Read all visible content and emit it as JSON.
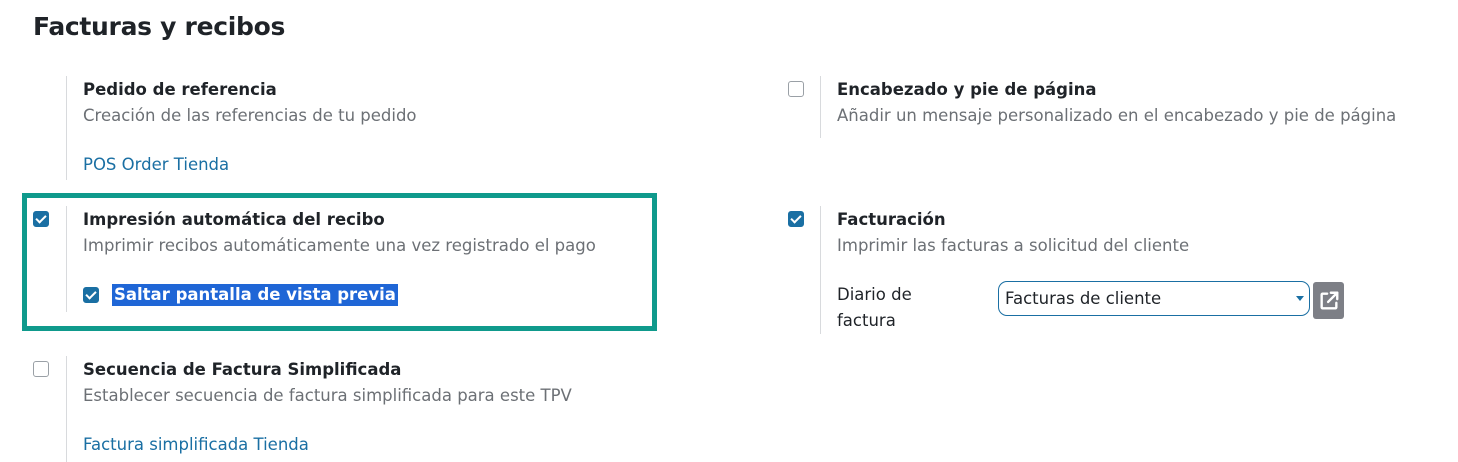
{
  "section": {
    "title": "Facturas y recibos"
  },
  "settings": {
    "order_reference": {
      "title": "Pedido de referencia",
      "description": "Creación de las referencias de tu pedido",
      "link": "POS Order Tienda"
    },
    "header_footer": {
      "checked": false,
      "title": "Encabezado y pie de página",
      "description": "Añadir un mensaje personalizado en el encabezado y pie de página"
    },
    "auto_print": {
      "checked": true,
      "title": "Impresión automática del recibo",
      "description": "Imprimir recibos automáticamente una vez registrado el pago",
      "sub_option": {
        "checked": true,
        "label": "Saltar pantalla de vista previa"
      }
    },
    "invoicing": {
      "checked": true,
      "title": "Facturación",
      "description": "Imprimir las facturas a solicitud del cliente",
      "journal_label_line1": "Diario de",
      "journal_label_line2": "factura",
      "journal_value": "Facturas de cliente",
      "external_link_icon": "external-link-icon"
    },
    "simplified_sequence": {
      "checked": false,
      "title": "Secuencia de Factura Simplificada",
      "description": "Establecer secuencia de factura simplificada para este TPV",
      "link": "Factura simplificada Tienda"
    }
  },
  "colors": {
    "accent": "#1a6fa3",
    "highlight_border": "#0f9a8c",
    "text_selection": "#1f66d6",
    "muted_text": "#6c7075"
  }
}
